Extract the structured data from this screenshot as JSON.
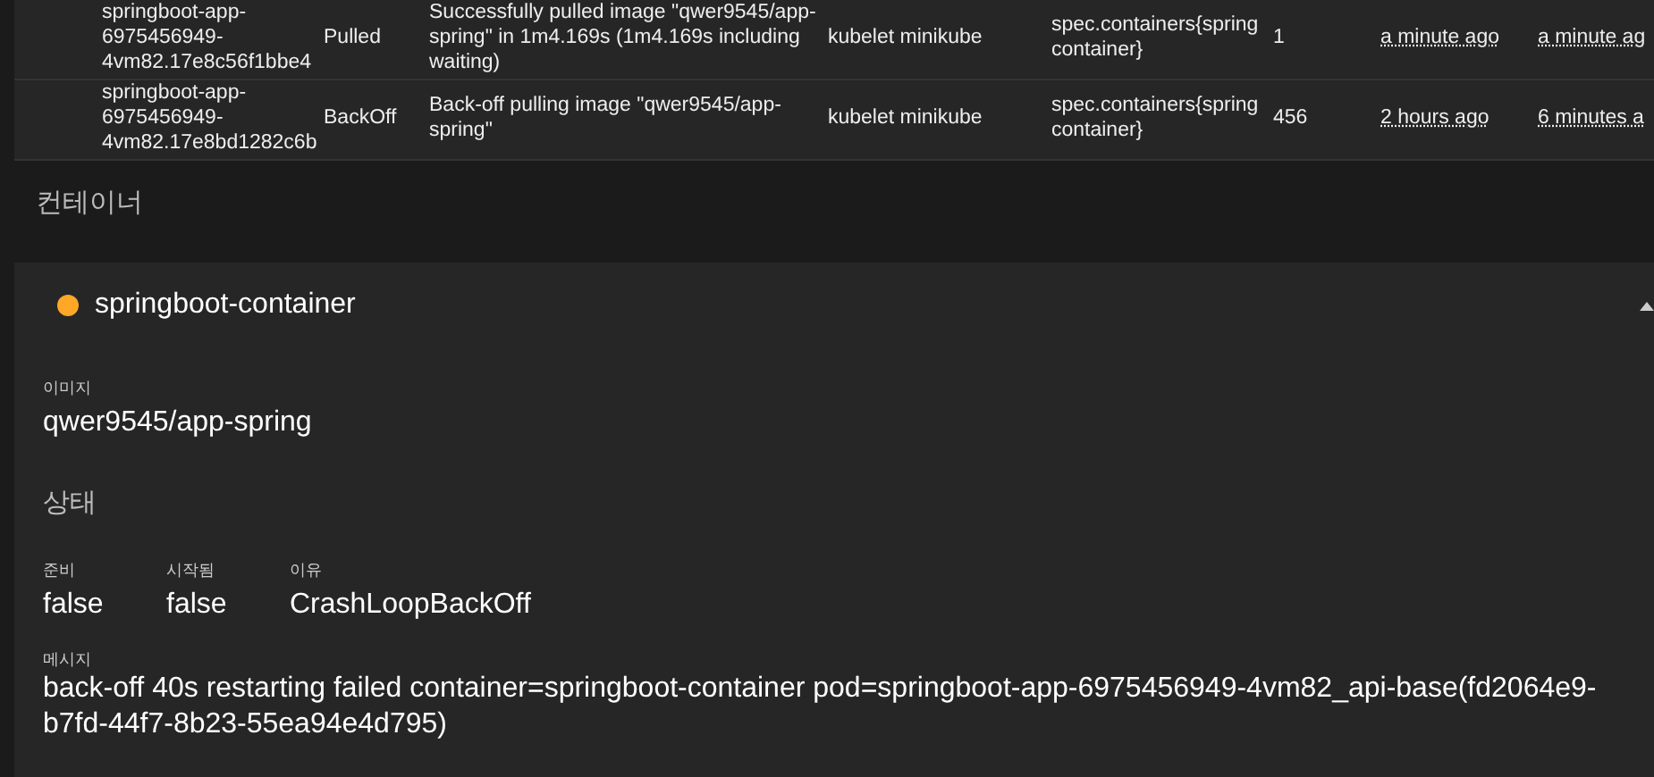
{
  "events": {
    "rows": [
      {
        "cells": [
          "springboot-app-6975456949-4vm82.17e8c56f1bbe4",
          "Pulled",
          "Successfully pulled image \"qwer9545/app-spring\" in 1m4.169s (1m4.169s including waiting)",
          "kubelet minikube",
          "spec.containers{spring container}",
          "1",
          "a minute ago",
          "a minute ag"
        ]
      },
      {
        "cells": [
          "springboot-app-6975456949-4vm82.17e8bd1282c6b",
          "BackOff",
          "Back-off pulling image \"qwer9545/app-spring\"",
          "kubelet minikube",
          "spec.containers{spring container}",
          "456",
          "2 hours ago",
          "6 minutes a"
        ]
      }
    ]
  },
  "containers_heading": "컨테이너",
  "container": {
    "name": "springboot-container",
    "color": "#ffa726",
    "expanded": true,
    "image_label": "이미지",
    "image": "qwer9545/app-spring",
    "status_heading": "상태",
    "fields": [
      {
        "label": "준비",
        "value": "false"
      },
      {
        "label": "시작됨",
        "value": "false"
      },
      {
        "label": "이유",
        "value": "CrashLoopBackOff"
      }
    ],
    "message_label": "메시지",
    "message": "back-off 40s restarting failed container=springboot-container pod=springboot-app-6975456949-4vm82_api-base(fd2064e9-b7fd-44f7-8b23-55ea94e4d795)"
  }
}
